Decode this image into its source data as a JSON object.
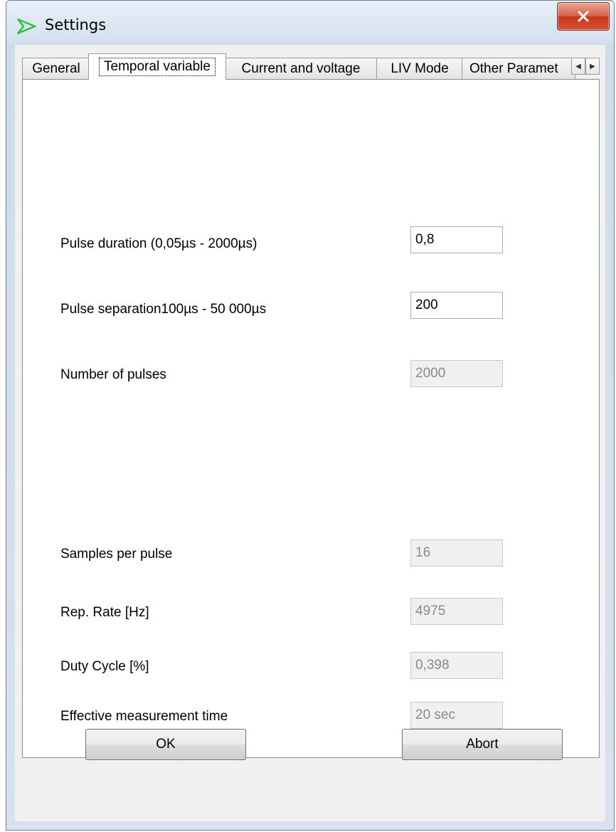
{
  "window": {
    "title": "Settings"
  },
  "tabs": [
    {
      "label": "General"
    },
    {
      "label": "Temporal variable"
    },
    {
      "label": "Current and voltage"
    },
    {
      "label": "LIV Mode"
    },
    {
      "label": "Other Paramet"
    }
  ],
  "active_tab": "Temporal variable",
  "fields": {
    "pulse_duration": {
      "label": "Pulse duration (0,05µs - 2000µs)",
      "value": "0,8"
    },
    "pulse_separation": {
      "label": "Pulse separation100µs - 50 000µs",
      "value": "200"
    },
    "number_of_pulses": {
      "label": "Number of pulses",
      "value": "2000"
    },
    "samples_per_pulse": {
      "label": "Samples per pulse",
      "value": "16"
    },
    "rep_rate": {
      "label": "Rep. Rate [Hz]",
      "value": "4975"
    },
    "duty_cycle": {
      "label": "Duty Cycle [%]",
      "value": "0,398"
    },
    "effective_time": {
      "label": "Effective measurement time",
      "value": "20 sec"
    }
  },
  "buttons": {
    "ok": "OK",
    "abort": "Abort"
  },
  "icons": {
    "app": "triangle-arrow-icon",
    "close": "close-icon",
    "scroll_left": "arrow-left-icon",
    "scroll_right": "arrow-right-icon"
  },
  "colors": {
    "close_button": "#d9502f",
    "app_icon": "#2fbf3a"
  }
}
